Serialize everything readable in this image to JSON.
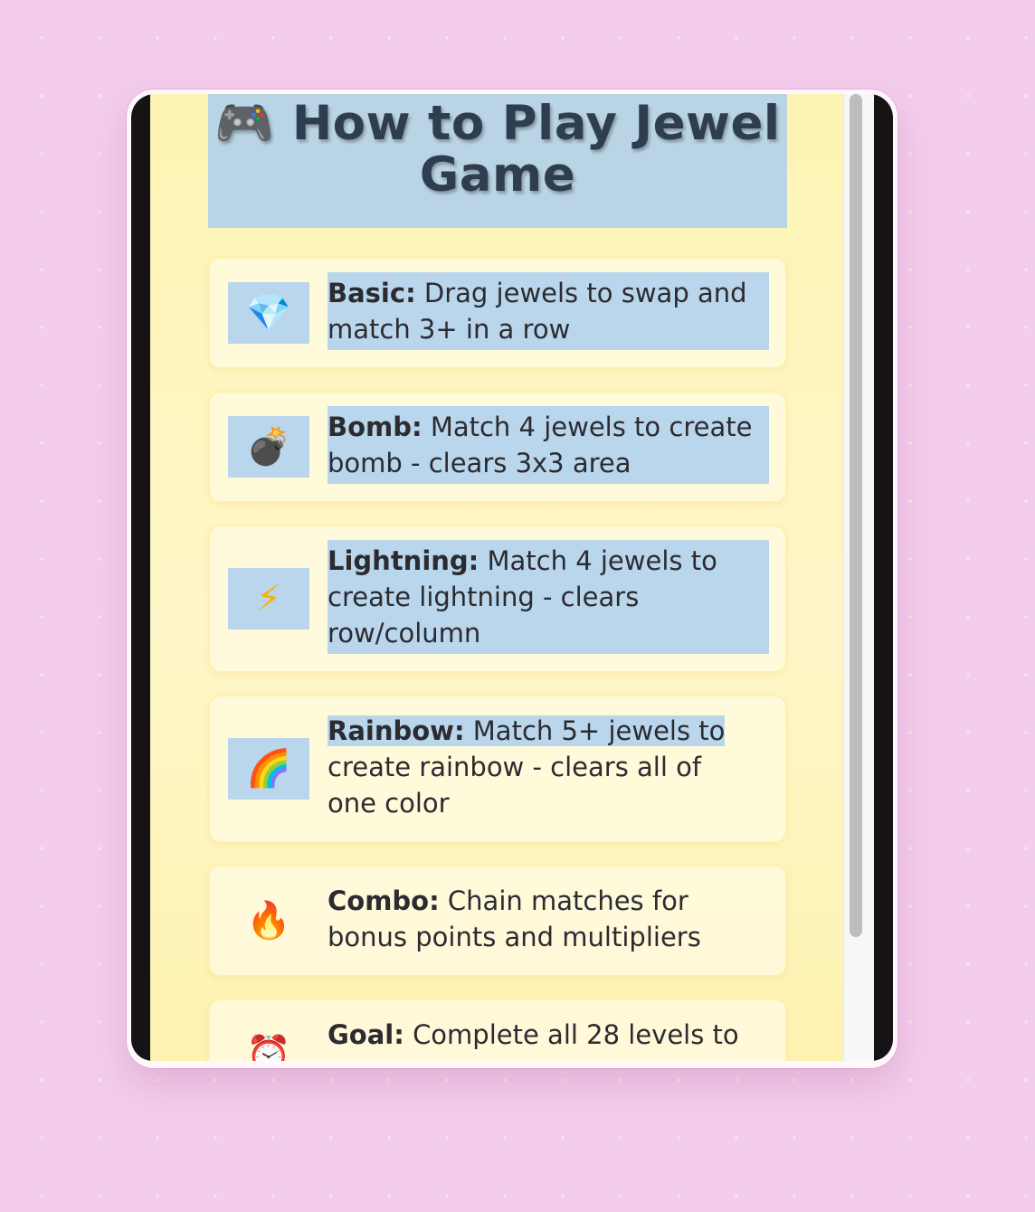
{
  "title": {
    "icon": "🎮",
    "text": "How to Play Jewel Game"
  },
  "rules": [
    {
      "icon": "💎",
      "icon_name": "gem-icon",
      "label": "Basic:",
      "text": "Drag jewels to swap and match 3+ in a row"
    },
    {
      "icon": "💣",
      "icon_name": "bomb-icon",
      "label": "Bomb:",
      "text": "Match 4 jewels to create bomb - clears 3x3 area"
    },
    {
      "icon": "⚡",
      "icon_name": "lightning-icon",
      "label": "Lightning:",
      "text": "Match 4 jewels to create lightning - clears row/column"
    },
    {
      "icon": "🌈",
      "icon_name": "rainbow-icon",
      "label": "Rainbow:",
      "text": "Match 5+ jewels to",
      "text_rest": "create rainbow - clears all of one color"
    },
    {
      "icon": "🔥",
      "icon_name": "fire-icon",
      "label": "Combo:",
      "text": "Chain matches for bonus points and multipliers"
    },
    {
      "icon": "⏰",
      "icon_name": "alarm-clock-icon",
      "label": "Goal:",
      "text": "Complete all 28 levels to"
    }
  ],
  "colors": {
    "background": "#f4cdec",
    "page": "#fdf3b3",
    "selection": "#b9d6ec",
    "title_text": "#2e3e50"
  }
}
